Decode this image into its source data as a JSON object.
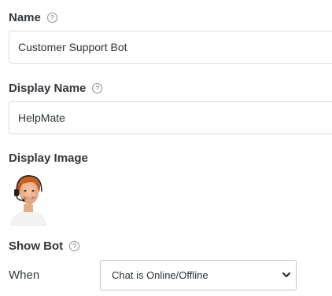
{
  "name_field": {
    "label": "Name",
    "value": "Customer Support Bot",
    "help_icon": "question-circle-icon"
  },
  "display_name_field": {
    "label": "Display Name",
    "value": "HelpMate",
    "help_icon": "question-circle-icon"
  },
  "display_image": {
    "label": "Display Image",
    "image_icon": "support-agent-avatar"
  },
  "show_bot": {
    "label": "Show Bot",
    "help_icon": "question-circle-icon",
    "when_label": "When",
    "selected_option": "Chat is Online/Offline"
  },
  "help_glyph": "?"
}
